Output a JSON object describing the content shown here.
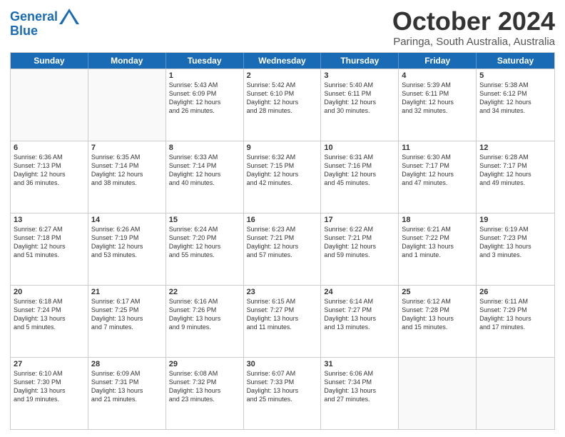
{
  "logo": {
    "line1": "General",
    "line2": "Blue"
  },
  "title": "October 2024",
  "subtitle": "Paringa, South Australia, Australia",
  "headers": [
    "Sunday",
    "Monday",
    "Tuesday",
    "Wednesday",
    "Thursday",
    "Friday",
    "Saturday"
  ],
  "rows": [
    [
      {
        "day": "",
        "text": ""
      },
      {
        "day": "",
        "text": ""
      },
      {
        "day": "1",
        "text": "Sunrise: 5:43 AM\nSunset: 6:09 PM\nDaylight: 12 hours\nand 26 minutes."
      },
      {
        "day": "2",
        "text": "Sunrise: 5:42 AM\nSunset: 6:10 PM\nDaylight: 12 hours\nand 28 minutes."
      },
      {
        "day": "3",
        "text": "Sunrise: 5:40 AM\nSunset: 6:11 PM\nDaylight: 12 hours\nand 30 minutes."
      },
      {
        "day": "4",
        "text": "Sunrise: 5:39 AM\nSunset: 6:11 PM\nDaylight: 12 hours\nand 32 minutes."
      },
      {
        "day": "5",
        "text": "Sunrise: 5:38 AM\nSunset: 6:12 PM\nDaylight: 12 hours\nand 34 minutes."
      }
    ],
    [
      {
        "day": "6",
        "text": "Sunrise: 6:36 AM\nSunset: 7:13 PM\nDaylight: 12 hours\nand 36 minutes."
      },
      {
        "day": "7",
        "text": "Sunrise: 6:35 AM\nSunset: 7:14 PM\nDaylight: 12 hours\nand 38 minutes."
      },
      {
        "day": "8",
        "text": "Sunrise: 6:33 AM\nSunset: 7:14 PM\nDaylight: 12 hours\nand 40 minutes."
      },
      {
        "day": "9",
        "text": "Sunrise: 6:32 AM\nSunset: 7:15 PM\nDaylight: 12 hours\nand 42 minutes."
      },
      {
        "day": "10",
        "text": "Sunrise: 6:31 AM\nSunset: 7:16 PM\nDaylight: 12 hours\nand 45 minutes."
      },
      {
        "day": "11",
        "text": "Sunrise: 6:30 AM\nSunset: 7:17 PM\nDaylight: 12 hours\nand 47 minutes."
      },
      {
        "day": "12",
        "text": "Sunrise: 6:28 AM\nSunset: 7:17 PM\nDaylight: 12 hours\nand 49 minutes."
      }
    ],
    [
      {
        "day": "13",
        "text": "Sunrise: 6:27 AM\nSunset: 7:18 PM\nDaylight: 12 hours\nand 51 minutes."
      },
      {
        "day": "14",
        "text": "Sunrise: 6:26 AM\nSunset: 7:19 PM\nDaylight: 12 hours\nand 53 minutes."
      },
      {
        "day": "15",
        "text": "Sunrise: 6:24 AM\nSunset: 7:20 PM\nDaylight: 12 hours\nand 55 minutes."
      },
      {
        "day": "16",
        "text": "Sunrise: 6:23 AM\nSunset: 7:21 PM\nDaylight: 12 hours\nand 57 minutes."
      },
      {
        "day": "17",
        "text": "Sunrise: 6:22 AM\nSunset: 7:21 PM\nDaylight: 12 hours\nand 59 minutes."
      },
      {
        "day": "18",
        "text": "Sunrise: 6:21 AM\nSunset: 7:22 PM\nDaylight: 13 hours\nand 1 minute."
      },
      {
        "day": "19",
        "text": "Sunrise: 6:19 AM\nSunset: 7:23 PM\nDaylight: 13 hours\nand 3 minutes."
      }
    ],
    [
      {
        "day": "20",
        "text": "Sunrise: 6:18 AM\nSunset: 7:24 PM\nDaylight: 13 hours\nand 5 minutes."
      },
      {
        "day": "21",
        "text": "Sunrise: 6:17 AM\nSunset: 7:25 PM\nDaylight: 13 hours\nand 7 minutes."
      },
      {
        "day": "22",
        "text": "Sunrise: 6:16 AM\nSunset: 7:26 PM\nDaylight: 13 hours\nand 9 minutes."
      },
      {
        "day": "23",
        "text": "Sunrise: 6:15 AM\nSunset: 7:27 PM\nDaylight: 13 hours\nand 11 minutes."
      },
      {
        "day": "24",
        "text": "Sunrise: 6:14 AM\nSunset: 7:27 PM\nDaylight: 13 hours\nand 13 minutes."
      },
      {
        "day": "25",
        "text": "Sunrise: 6:12 AM\nSunset: 7:28 PM\nDaylight: 13 hours\nand 15 minutes."
      },
      {
        "day": "26",
        "text": "Sunrise: 6:11 AM\nSunset: 7:29 PM\nDaylight: 13 hours\nand 17 minutes."
      }
    ],
    [
      {
        "day": "27",
        "text": "Sunrise: 6:10 AM\nSunset: 7:30 PM\nDaylight: 13 hours\nand 19 minutes."
      },
      {
        "day": "28",
        "text": "Sunrise: 6:09 AM\nSunset: 7:31 PM\nDaylight: 13 hours\nand 21 minutes."
      },
      {
        "day": "29",
        "text": "Sunrise: 6:08 AM\nSunset: 7:32 PM\nDaylight: 13 hours\nand 23 minutes."
      },
      {
        "day": "30",
        "text": "Sunrise: 6:07 AM\nSunset: 7:33 PM\nDaylight: 13 hours\nand 25 minutes."
      },
      {
        "day": "31",
        "text": "Sunrise: 6:06 AM\nSunset: 7:34 PM\nDaylight: 13 hours\nand 27 minutes."
      },
      {
        "day": "",
        "text": ""
      },
      {
        "day": "",
        "text": ""
      }
    ]
  ]
}
